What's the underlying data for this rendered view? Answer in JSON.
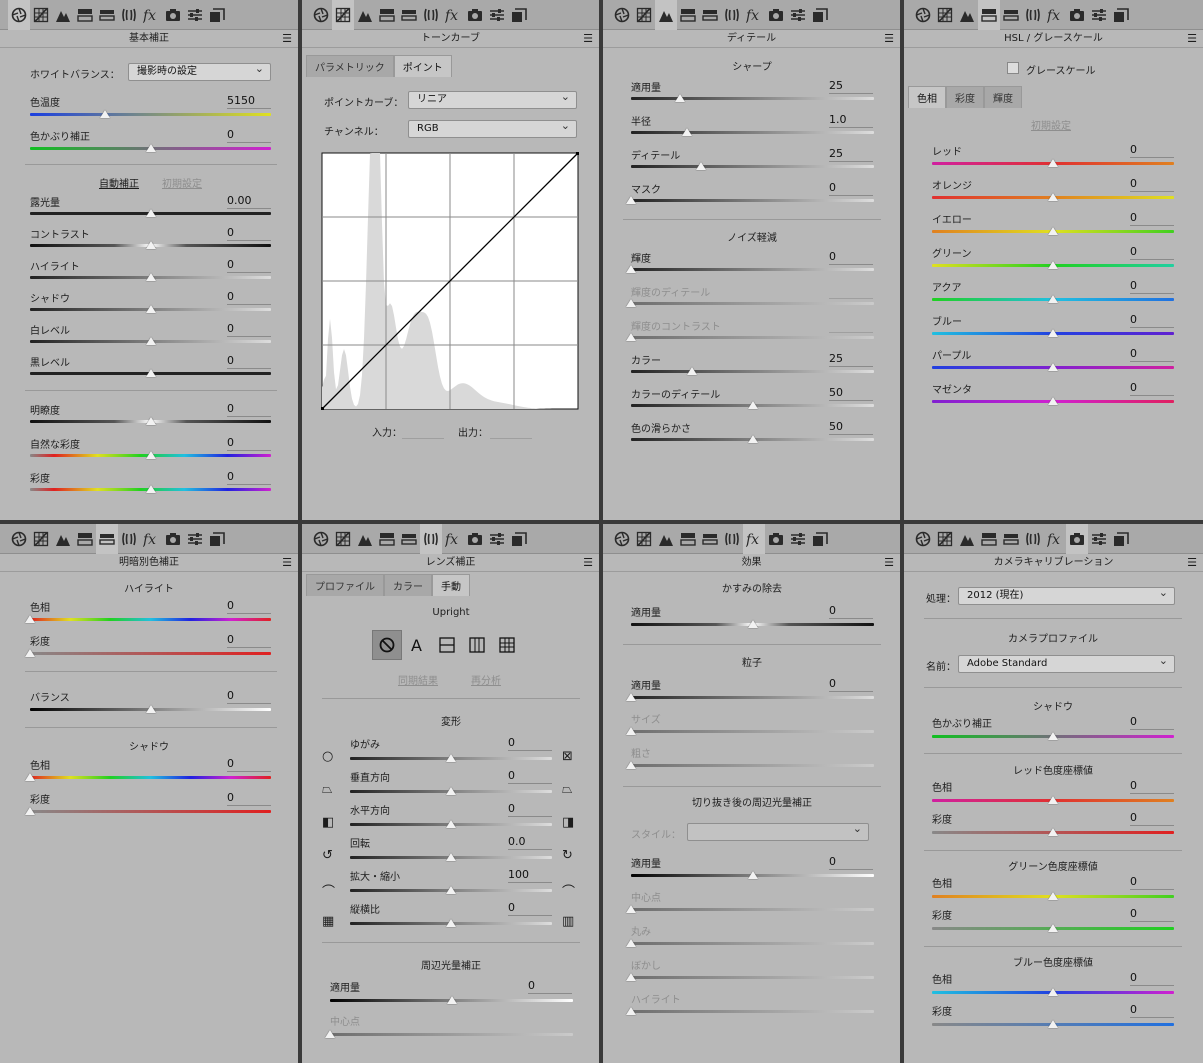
{
  "toolbar_icons": [
    "basic-icon",
    "tone-curve-icon",
    "detail-icon",
    "hsl-icon",
    "split-toning-icon",
    "lens-icon",
    "fx-icon",
    "camera-icon",
    "presets-icon",
    "snapshots-icon"
  ],
  "basic": {
    "title": "基本補正",
    "wb_label": "ホワイトバランス：",
    "wb_value": "撮影時の設定",
    "temp_label": "色温度",
    "temp_value": "5150",
    "tint_label": "色かぶり補正",
    "tint_value": "0",
    "auto": "自動補正",
    "default": "初期設定",
    "sliders": [
      {
        "label": "露光量",
        "value": "0.00"
      },
      {
        "label": "コントラスト",
        "value": "0"
      },
      {
        "label": "ハイライト",
        "value": "0"
      },
      {
        "label": "シャドウ",
        "value": "0"
      },
      {
        "label": "白レベル",
        "value": "0"
      },
      {
        "label": "黒レベル",
        "value": "0"
      }
    ],
    "presence": [
      {
        "label": "明瞭度",
        "value": "0"
      },
      {
        "label": "自然な彩度",
        "value": "0"
      },
      {
        "label": "彩度",
        "value": "0"
      }
    ]
  },
  "tone": {
    "title": "トーンカーブ",
    "tab1": "パラメトリック",
    "tab2": "ポイント",
    "pc_label": "ポイントカーブ：",
    "pc_value": "リニア",
    "ch_label": "チャンネル：",
    "ch_value": "RGB",
    "in_label": "入力：",
    "out_label": "出力："
  },
  "detail": {
    "title": "ディテール",
    "sharp": "シャープ",
    "sharp_sliders": [
      {
        "label": "適用量",
        "value": "25"
      },
      {
        "label": "半径",
        "value": "1.0"
      },
      {
        "label": "ディテール",
        "value": "25"
      },
      {
        "label": "マスク",
        "value": "0"
      }
    ],
    "noise": "ノイズ軽減",
    "noise_sliders": [
      {
        "label": "輝度",
        "value": "0"
      },
      {
        "label": "輝度のディテール",
        "value": ""
      },
      {
        "label": "輝度のコントラスト",
        "value": ""
      },
      {
        "label": "カラー",
        "value": "25"
      },
      {
        "label": "カラーのディテール",
        "value": "50"
      },
      {
        "label": "色の滑らかさ",
        "value": "50"
      }
    ]
  },
  "hsl": {
    "title": "HSL / グレースケール",
    "gray": "グレースケール",
    "tabs": [
      "色相",
      "彩度",
      "輝度"
    ],
    "default": "初期設定",
    "sliders": [
      {
        "label": "レッド",
        "value": "0"
      },
      {
        "label": "オレンジ",
        "value": "0"
      },
      {
        "label": "イエロー",
        "value": "0"
      },
      {
        "label": "グリーン",
        "value": "0"
      },
      {
        "label": "アクア",
        "value": "0"
      },
      {
        "label": "ブルー",
        "value": "0"
      },
      {
        "label": "パープル",
        "value": "0"
      },
      {
        "label": "マゼンタ",
        "value": "0"
      }
    ]
  },
  "split": {
    "title": "明暗別色補正",
    "hl": "ハイライト",
    "hue": "色相",
    "sat": "彩度",
    "hl_hue": "0",
    "hl_sat": "0",
    "bal": "バランス",
    "bal_value": "0",
    "sh": "シャドウ",
    "sh_hue": "0",
    "sh_sat": "0"
  },
  "lens": {
    "title": "レンズ補正",
    "tabs": [
      "プロファイル",
      "カラー",
      "手動"
    ],
    "upright": "Upright",
    "sync": "同期結果",
    "reanalyze": "再分析",
    "transform": "変形",
    "sliders": [
      {
        "label": "ゆがみ",
        "value": "0"
      },
      {
        "label": "垂直方向",
        "value": "0"
      },
      {
        "label": "水平方向",
        "value": "0"
      },
      {
        "label": "回転",
        "value": "0.0"
      },
      {
        "label": "拡大・縮小",
        "value": "100"
      },
      {
        "label": "縦横比",
        "value": "0"
      }
    ],
    "vignette": "周辺光量補正",
    "amount": "適用量",
    "amount_value": "0",
    "midpoint": "中心点"
  },
  "effects": {
    "title": "効果",
    "dehaze": "かすみの除去",
    "amount": "適用量",
    "dehaze_value": "0",
    "grain": "粒子",
    "grain_value": "0",
    "size": "サイズ",
    "rough": "粗さ",
    "vig": "切り抜き後の周辺光量補正",
    "style": "スタイル：",
    "vig_value": "0",
    "mid": "中心点",
    "round": "丸み",
    "feather": "ぼかし",
    "highlight": "ハイライト"
  },
  "calib": {
    "title": "カメラキャリブレーション",
    "proc_label": "処理：",
    "proc_value": "2012 (現在)",
    "profile": "カメラプロファイル",
    "name_label": "名前：",
    "name_value": "Adobe Standard",
    "shadow": "シャドウ",
    "tint": "色かぶり補正",
    "tint_value": "0",
    "red": "レッド色度座標値",
    "green": "グリーン色度座標値",
    "blue": "ブルー色度座標値",
    "hue": "色相",
    "sat": "彩度",
    "red_hue": "0",
    "red_sat": "0",
    "green_hue": "0",
    "green_sat": "0",
    "blue_hue": "0",
    "blue_sat": "0"
  }
}
